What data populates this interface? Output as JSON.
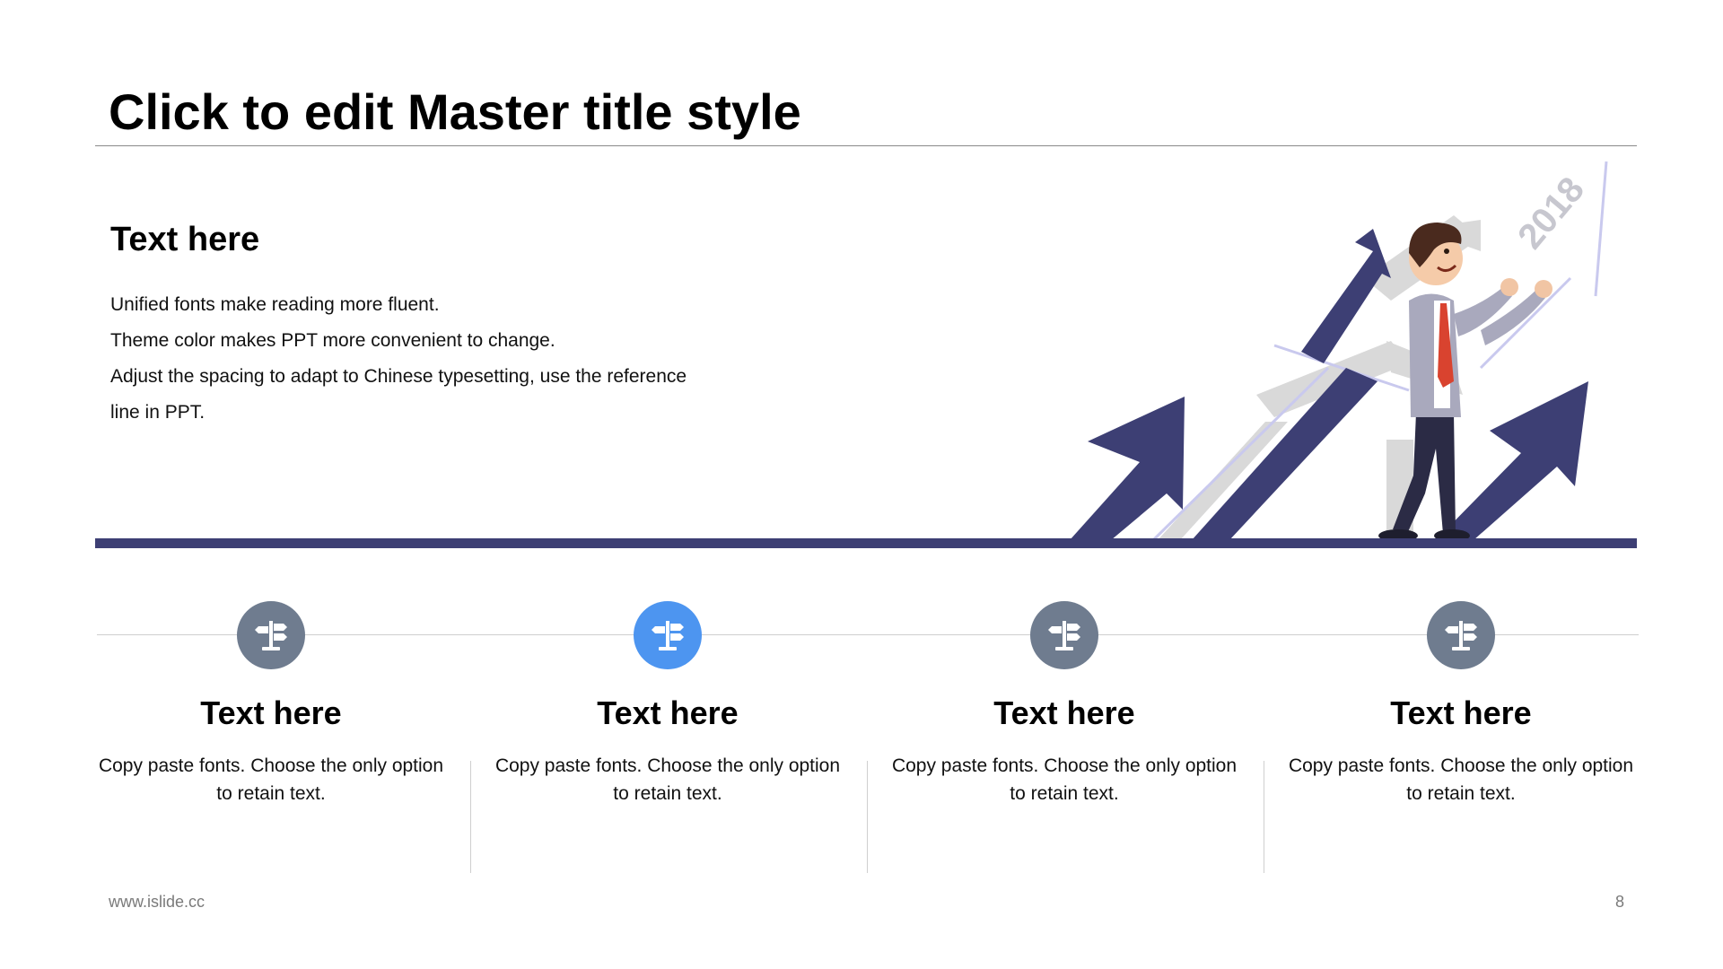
{
  "slide": {
    "title": "Click to edit Master title style",
    "heading": "Text here",
    "body_lines": [
      "Unified fonts make reading more fluent.",
      "Theme color makes PPT more convenient  to change.",
      "Adjust the spacing to adapt to Chinese  typesetting,  use the reference",
      "line  in PPT."
    ]
  },
  "illustration": {
    "year_label": "2018",
    "arrow_color": "#3d3f74",
    "shadow_color": "#d6d6d6"
  },
  "colors": {
    "accent_navy": "#3d3f74",
    "icon_gray": "#6f7c8f",
    "icon_blue": "#4d95f0"
  },
  "features": [
    {
      "title": "Text here",
      "desc": "Copy paste fonts. Choose the only option to retain text.",
      "icon": "signpost-icon",
      "color": "#6f7c8f"
    },
    {
      "title": "Text here",
      "desc": "Copy paste fonts. Choose the only option to retain text.",
      "icon": "signpost-icon",
      "color": "#4d95f0"
    },
    {
      "title": "Text here",
      "desc": "Copy paste fonts. Choose the only option to retain text.",
      "icon": "signpost-icon",
      "color": "#6f7c8f"
    },
    {
      "title": "Text here",
      "desc": "Copy paste fonts. Choose the only option to retain text.",
      "icon": "signpost-icon",
      "color": "#6f7c8f"
    }
  ],
  "footer": {
    "url": "www.islide.cc",
    "page_number": "8"
  }
}
